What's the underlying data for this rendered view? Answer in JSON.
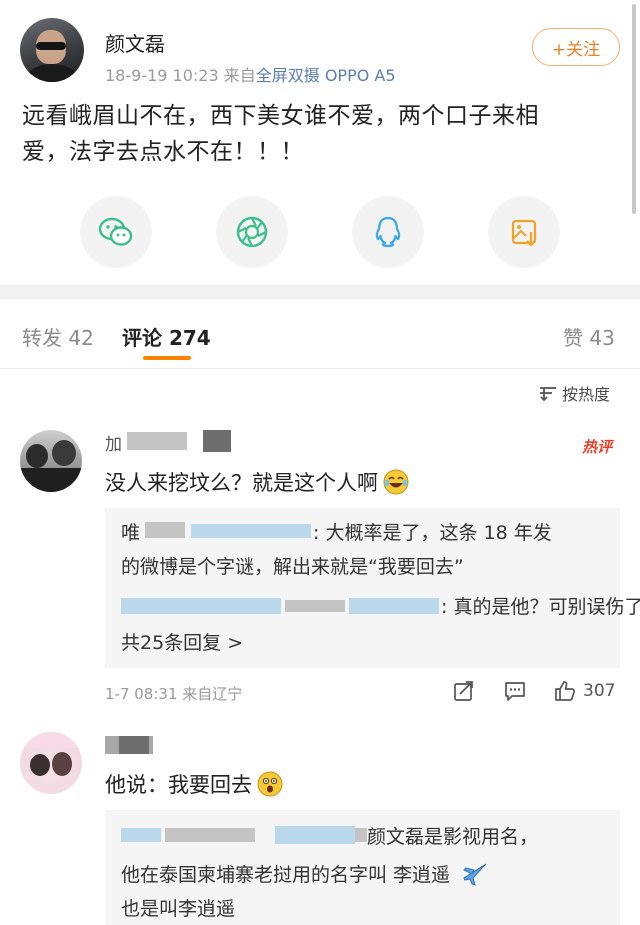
{
  "post": {
    "username": "颜文磊",
    "timestamp": "18-9-19 10:23",
    "source_prefix": "来自",
    "source_name": "全屏双摄 OPPO A5",
    "follow_label": "+关注",
    "text_line1": "远看峨眉山不在，西下美女谁不爱，两个口子来相",
    "text_line2": "爱，法字去点水不在！！！",
    "share_icons": [
      "wechat-icon",
      "moments-icon",
      "qq-icon",
      "save-image-icon"
    ]
  },
  "tabs": {
    "repost_label": "转发",
    "repost_count": "42",
    "comment_label": "评论",
    "comment_count": "274",
    "like_label": "赞",
    "like_count": "43"
  },
  "sort": {
    "label": "按热度",
    "icon": "sort-icon"
  },
  "comments": [
    {
      "name_prefix": "加",
      "badge": "热评",
      "text": "没人来挖坟么？就是这个人啊",
      "emoji": "laugh-cry-emoji",
      "replies": [
        {
          "name_prefix": "唯",
          "text_line1": ": 大概率是了，这条 18 年发",
          "text_line2": "的微博是个字谜，解出来就是“我要回去”"
        },
        {
          "text": ": 真的是他？可别误伤了"
        }
      ],
      "more_replies": "共25条回复 >",
      "meta": "1-7 08:31  来自辽宁",
      "like_count": "307"
    },
    {
      "text": "他说：我要回去",
      "emoji": "shocked-emoji",
      "reply": {
        "text_line1": "颜文磊是影视用名，",
        "text_line2": "他在泰国柬埔寨老挝用的名字叫 李逍遥",
        "text_line3": "也是叫李逍遥",
        "emoji": "airplane-emoji"
      }
    }
  ],
  "colors": {
    "accent": "#ff8200",
    "link": "#4f7cb5",
    "hot": "#e8442e",
    "follow": "#e8822c"
  }
}
